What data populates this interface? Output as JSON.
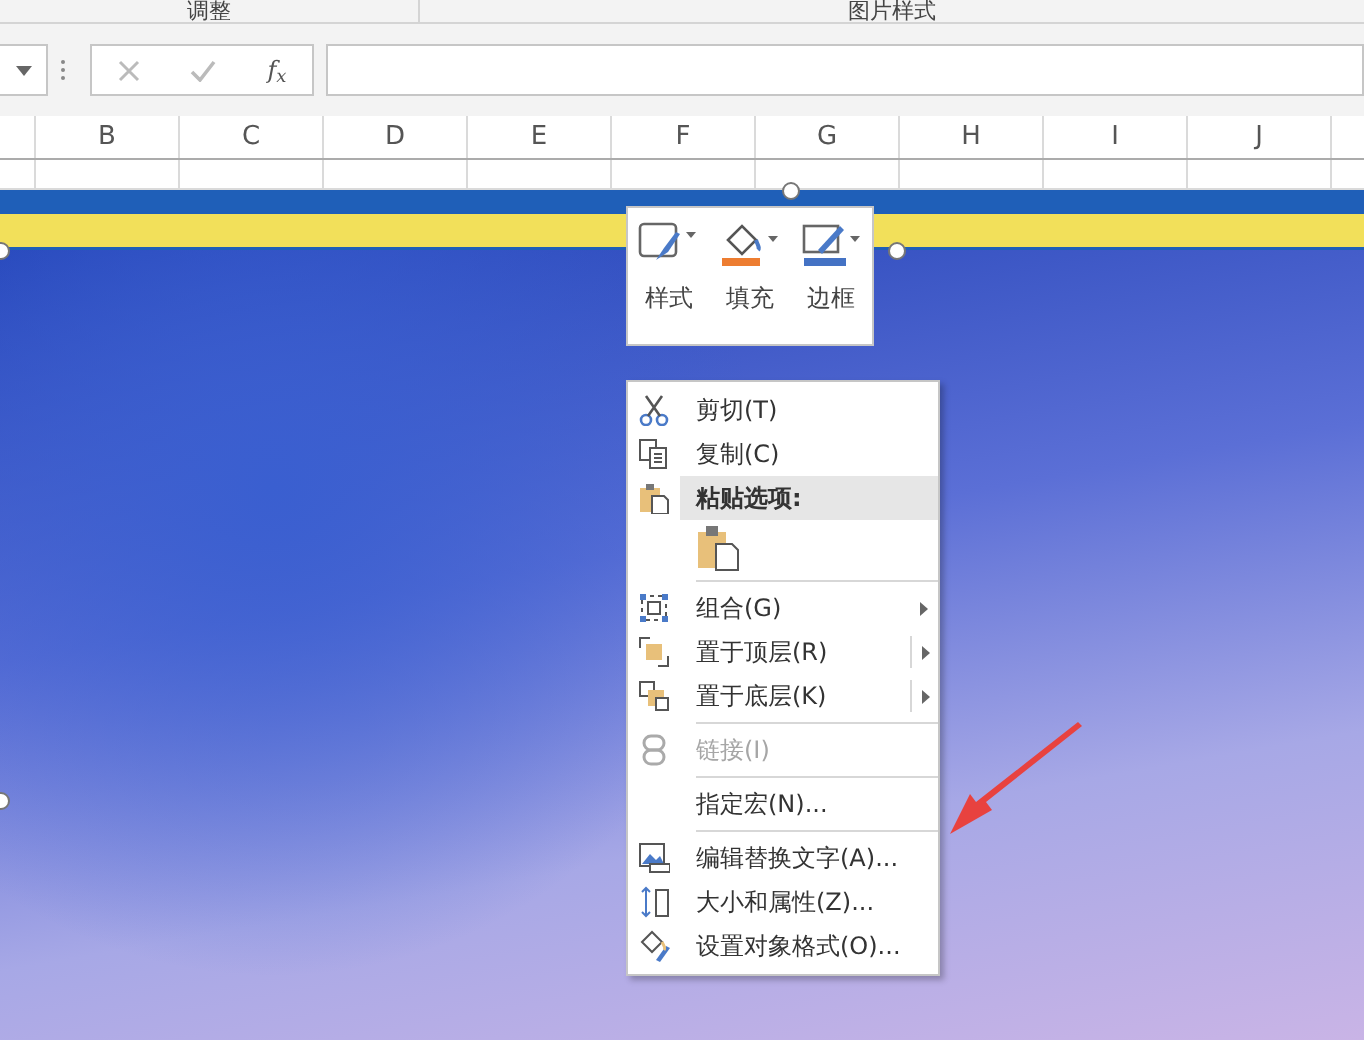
{
  "ribbon_groups": [
    "调整",
    "图片样式"
  ],
  "formula_bar": {
    "function_label": "f$_{x}$"
  },
  "columns": [
    "B",
    "C",
    "D",
    "E",
    "F",
    "G",
    "H",
    "I",
    "J"
  ],
  "mini_toolbar": [
    {
      "label": "样式",
      "kind": "style"
    },
    {
      "label": "填充",
      "kind": "fill",
      "color": "#ed7d31"
    },
    {
      "label": "边框",
      "kind": "outline",
      "color": "#4472c4"
    }
  ],
  "context_menu": [
    {
      "kind": "item",
      "label": "剪切(T)",
      "disabled": false,
      "submenu": false
    },
    {
      "kind": "item",
      "label": "复制(C)",
      "disabled": false,
      "submenu": false
    },
    {
      "kind": "header",
      "label": "粘贴选项:"
    },
    {
      "kind": "paste"
    },
    {
      "kind": "separator"
    },
    {
      "kind": "item",
      "label": "组合(G)",
      "disabled": false,
      "submenu": true
    },
    {
      "kind": "item",
      "label": "置于顶层(R)",
      "disabled": false,
      "submenu": true
    },
    {
      "kind": "item",
      "label": "置于底层(K)",
      "disabled": false,
      "submenu": true
    },
    {
      "kind": "separator"
    },
    {
      "kind": "item",
      "label": "链接(I)",
      "disabled": true,
      "submenu": false
    },
    {
      "kind": "separator"
    },
    {
      "kind": "item",
      "label": "指定宏(N)...",
      "disabled": false,
      "submenu": false
    },
    {
      "kind": "separator"
    },
    {
      "kind": "item",
      "label": "编辑替换文字(A)...",
      "disabled": false,
      "submenu": false
    },
    {
      "kind": "item",
      "label": "大小和属性(Z)...",
      "disabled": false,
      "submenu": false
    },
    {
      "kind": "item",
      "label": "设置对象格式(O)...",
      "disabled": false,
      "submenu": false
    }
  ]
}
